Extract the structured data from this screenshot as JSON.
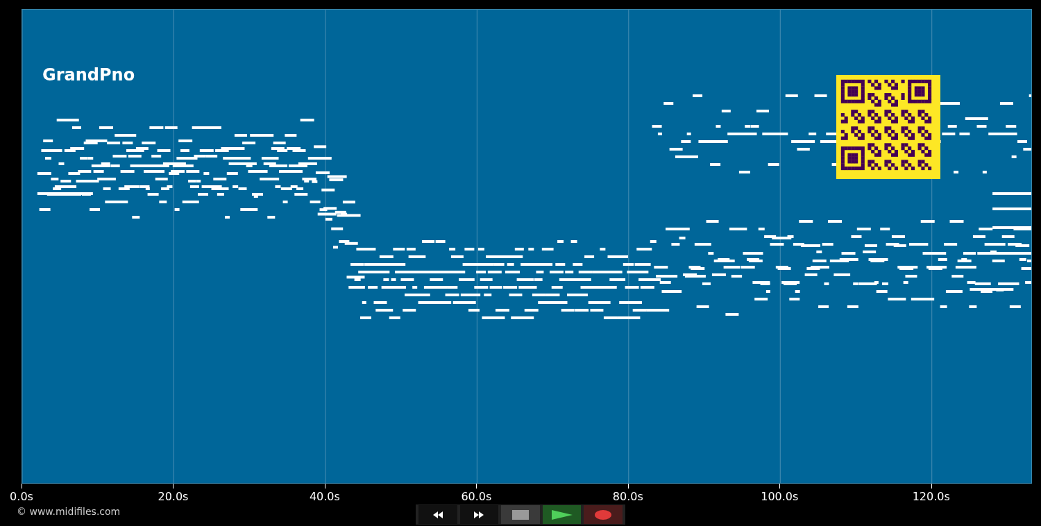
{
  "track": {
    "name": "GrandPno"
  },
  "x_axis": {
    "ticks": [
      "0.0s",
      "20.0s",
      "40.0s",
      "60.0s",
      "80.0s",
      "100.0s",
      "120.0s"
    ]
  },
  "copyright": "© www.midifiles.com",
  "transport": [
    {
      "kind": "rewind"
    },
    {
      "kind": "forward"
    },
    {
      "kind": "stop"
    },
    {
      "kind": "play"
    },
    {
      "kind": "record"
    }
  ]
}
